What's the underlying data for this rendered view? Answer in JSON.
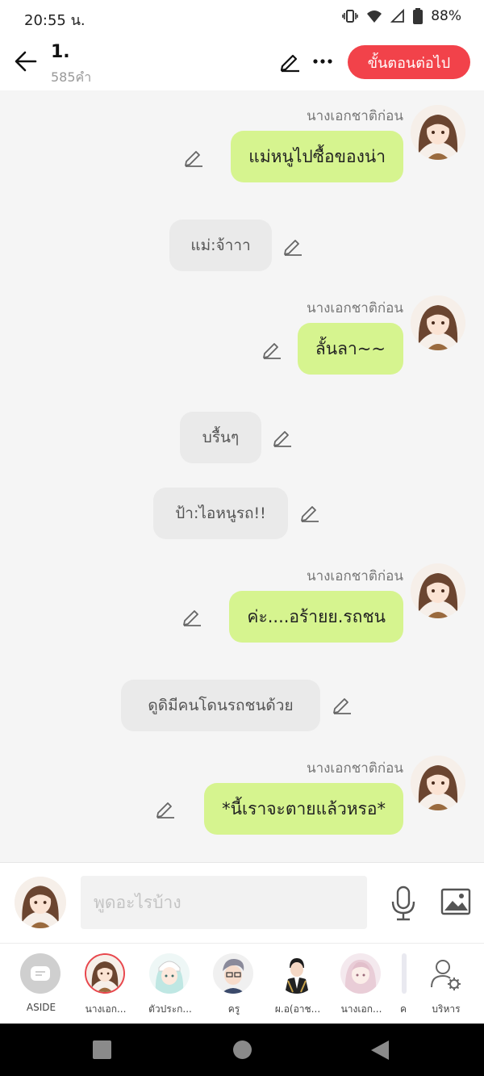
{
  "status_bar": {
    "time": "20:55 น.",
    "battery": "88%"
  },
  "header": {
    "title": "1.",
    "word_count": "585คำ",
    "next_button": "ขั้นตอนต่อไป"
  },
  "messages": [
    {
      "kind": "main",
      "speaker": "นางเอกชาติก่อน",
      "text": "แม่หนูไปซื้อของน่า"
    },
    {
      "kind": "other",
      "text": "แม่:จ้าาา"
    },
    {
      "kind": "main",
      "speaker": "นางเอกชาติก่อน",
      "text": "ลั้นลา~~"
    },
    {
      "kind": "other",
      "text": "บรื้นๆ"
    },
    {
      "kind": "other",
      "text": "ป้า:ไอหนูรถ!!"
    },
    {
      "kind": "main",
      "speaker": "นางเอกชาติก่อน",
      "text": "ค่ะ....อร้ายย.รถชน"
    },
    {
      "kind": "other",
      "text": "ดูดิมีคนโดนรถชนด้วย"
    },
    {
      "kind": "main",
      "speaker": "นางเอกชาติก่อน",
      "text": "*นี้เราจะตายแล้วหรอ*"
    }
  ],
  "composer": {
    "placeholder": "พูดอะไรบ้าง"
  },
  "characters": [
    {
      "label": "ASIDE"
    },
    {
      "label": "นางเอก..."
    },
    {
      "label": "ตัวประก..."
    },
    {
      "label": "ครู"
    },
    {
      "label": "ผ.อ(อาช..."
    },
    {
      "label": "นางเอก..."
    },
    {
      "label": "ค"
    },
    {
      "label": "บริหาร"
    }
  ],
  "colors": {
    "accent_red": "#f2424a",
    "bubble_green": "#d6f48f",
    "bubble_gray": "#eaeaea"
  }
}
